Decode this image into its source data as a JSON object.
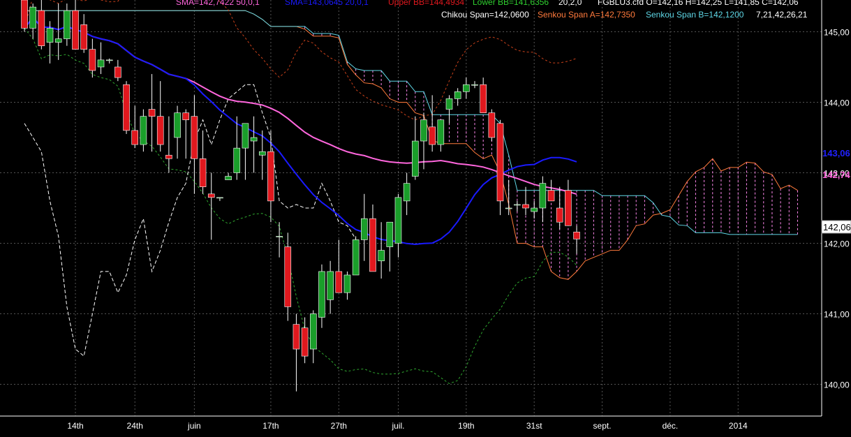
{
  "header": {
    "sma1": "SMA=142,7422  50,0,1",
    "sma2": "SMA=143,0645  20,0,1",
    "upper_bb": "Upper BB=144,4934",
    "lower_bb": "Lower BB=141,6356",
    "bb_params": "20,2,0",
    "ohlc": "FGBLU3.cfd O=142,16 H=142,25 L=141,85 C=142,06",
    "chikou": "Chikou Span=142,0600",
    "senkou_a": "Senkou Span A=142,7350",
    "senkou_b": "Senkou Span B=142,1200",
    "ichimoku_params": "7,21,42,26,21"
  },
  "price_labels": {
    "sma20": "143,06",
    "sma50": "142,74",
    "close": "142,06"
  },
  "colors": {
    "background": "#000000",
    "grid": "#555555",
    "up_candle": "#1a9e2a",
    "down_candle": "#e0181e",
    "sma20": "#1a1aff",
    "sma50": "#ff66dd",
    "chikou": "#ffffff",
    "senkou_a": "#ff7a3c",
    "senkou_b": "#5fd7e6",
    "upper_bb": "#c8401a",
    "lower_bb": "#2fa82f",
    "cloud_hatch": "#ff88ee"
  },
  "chart_data": {
    "type": "candlestick",
    "symbol": "FGBLU3.cfd",
    "ylim": [
      139.55,
      145.45
    ],
    "y_ticks": [
      140,
      141,
      142,
      143,
      144,
      145
    ],
    "y_tick_labels": [
      "140,00",
      "141,00",
      "142,00",
      "143,00",
      "144,00",
      "145,00"
    ],
    "x_tick_labels": [
      {
        "label": "14th",
        "idx": 6
      },
      {
        "label": "24th",
        "idx": 13
      },
      {
        "label": "juin",
        "idx": 20
      },
      {
        "label": "17th",
        "idx": 29
      },
      {
        "label": "27th",
        "idx": 37
      },
      {
        "label": "juil.",
        "idx": 44
      },
      {
        "label": "19th",
        "idx": 52
      },
      {
        "label": "31st",
        "idx": 60
      },
      {
        "label": "sept.",
        "idx": 68
      },
      {
        "label": "déc.",
        "idx": 76
      },
      {
        "label": "2014",
        "idx": 84
      }
    ],
    "candles": [
      {
        "o": 145.45,
        "h": 145.6,
        "l": 145.0,
        "c": 145.05
      },
      {
        "o": 145.05,
        "h": 145.4,
        "l": 144.9,
        "c": 145.35
      },
      {
        "o": 145.3,
        "h": 145.45,
        "l": 144.75,
        "c": 144.8
      },
      {
        "o": 144.85,
        "h": 145.15,
        "l": 144.55,
        "c": 145.05
      },
      {
        "o": 144.85,
        "h": 145.4,
        "l": 144.6,
        "c": 144.9
      },
      {
        "o": 144.9,
        "h": 145.4,
        "l": 144.8,
        "c": 145.3
      },
      {
        "o": 145.3,
        "h": 145.45,
        "l": 144.75,
        "c": 144.75
      },
      {
        "o": 145.1,
        "h": 145.25,
        "l": 144.7,
        "c": 144.75
      },
      {
        "o": 144.75,
        "h": 144.9,
        "l": 144.35,
        "c": 144.45
      },
      {
        "o": 144.5,
        "h": 144.85,
        "l": 144.4,
        "c": 144.6
      },
      {
        "o": 144.6,
        "h": 144.62,
        "l": 144.55,
        "c": 144.6
      },
      {
        "o": 144.5,
        "h": 144.6,
        "l": 144.3,
        "c": 144.35
      },
      {
        "o": 144.25,
        "h": 144.3,
        "l": 143.55,
        "c": 143.6
      },
      {
        "o": 143.6,
        "h": 143.95,
        "l": 143.35,
        "c": 143.4
      },
      {
        "o": 143.4,
        "h": 143.9,
        "l": 143.3,
        "c": 143.8
      },
      {
        "o": 143.9,
        "h": 144.4,
        "l": 143.3,
        "c": 143.8
      },
      {
        "o": 143.8,
        "h": 144.3,
        "l": 143.3,
        "c": 143.4
      },
      {
        "o": 143.25,
        "h": 143.8,
        "l": 143.0,
        "c": 143.2
      },
      {
        "o": 143.5,
        "h": 143.95,
        "l": 143.2,
        "c": 143.85
      },
      {
        "o": 143.85,
        "h": 143.9,
        "l": 143.2,
        "c": 143.75
      },
      {
        "o": 143.8,
        "h": 144.1,
        "l": 142.7,
        "c": 143.2
      },
      {
        "o": 143.2,
        "h": 143.6,
        "l": 142.7,
        "c": 142.8
      },
      {
        "o": 142.7,
        "h": 143.0,
        "l": 142.05,
        "c": 142.65
      },
      {
        "o": 142.65,
        "h": 142.65,
        "l": 142.6,
        "c": 142.65
      },
      {
        "o": 142.9,
        "h": 143.0,
        "l": 142.9,
        "c": 142.95
      },
      {
        "o": 143.0,
        "h": 143.8,
        "l": 142.9,
        "c": 143.35
      },
      {
        "o": 143.35,
        "h": 143.7,
        "l": 142.9,
        "c": 143.7
      },
      {
        "o": 143.45,
        "h": 143.8,
        "l": 143.0,
        "c": 143.5
      },
      {
        "o": 143.25,
        "h": 143.6,
        "l": 142.9,
        "c": 143.3
      },
      {
        "o": 143.3,
        "h": 143.6,
        "l": 142.3,
        "c": 142.6
      },
      {
        "o": 142.1,
        "h": 142.3,
        "l": 141.8,
        "c": 142.1
      },
      {
        "o": 141.95,
        "h": 142.15,
        "l": 140.9,
        "c": 141.1
      },
      {
        "o": 140.85,
        "h": 141.0,
        "l": 139.9,
        "c": 140.5
      },
      {
        "o": 140.8,
        "h": 140.95,
        "l": 140.3,
        "c": 140.4
      },
      {
        "o": 140.5,
        "h": 141.05,
        "l": 140.3,
        "c": 141.0
      },
      {
        "o": 140.95,
        "h": 141.7,
        "l": 140.8,
        "c": 141.6
      },
      {
        "o": 141.2,
        "h": 141.75,
        "l": 141.0,
        "c": 141.6
      },
      {
        "o": 141.6,
        "h": 142.05,
        "l": 141.4,
        "c": 141.3
      },
      {
        "o": 141.3,
        "h": 141.6,
        "l": 141.2,
        "c": 141.55
      },
      {
        "o": 141.55,
        "h": 142.1,
        "l": 141.55,
        "c": 142.05
      },
      {
        "o": 142.05,
        "h": 142.7,
        "l": 141.75,
        "c": 142.35
      },
      {
        "o": 142.35,
        "h": 142.55,
        "l": 141.7,
        "c": 141.6
      },
      {
        "o": 141.75,
        "h": 142.3,
        "l": 141.5,
        "c": 141.9
      },
      {
        "o": 141.95,
        "h": 142.25,
        "l": 141.6,
        "c": 142.3
      },
      {
        "o": 142.0,
        "h": 142.7,
        "l": 141.8,
        "c": 142.65
      },
      {
        "o": 142.6,
        "h": 143.0,
        "l": 142.4,
        "c": 142.85
      },
      {
        "o": 142.95,
        "h": 143.8,
        "l": 142.9,
        "c": 143.45
      },
      {
        "o": 143.45,
        "h": 143.85,
        "l": 143.05,
        "c": 143.75
      },
      {
        "o": 143.65,
        "h": 144.1,
        "l": 143.3,
        "c": 143.4
      },
      {
        "o": 143.4,
        "h": 143.75,
        "l": 143.3,
        "c": 143.75
      },
      {
        "o": 143.9,
        "h": 144.1,
        "l": 143.7,
        "c": 144.05
      },
      {
        "o": 144.05,
        "h": 144.2,
        "l": 143.95,
        "c": 144.15
      },
      {
        "o": 144.15,
        "h": 144.35,
        "l": 144.05,
        "c": 144.25
      },
      {
        "o": 144.25,
        "h": 144.3,
        "l": 144.2,
        "c": 144.25
      },
      {
        "o": 144.25,
        "h": 144.35,
        "l": 144.1,
        "c": 143.85
      },
      {
        "o": 143.85,
        "h": 143.9,
        "l": 143.45,
        "c": 143.5
      },
      {
        "o": 143.7,
        "h": 143.75,
        "l": 142.4,
        "c": 142.6
      },
      {
        "o": 142.5,
        "h": 142.9,
        "l": 142.4,
        "c": 142.5
      },
      {
        "o": 142.55,
        "h": 142.6,
        "l": 142.45,
        "c": 142.55
      },
      {
        "o": 142.55,
        "h": 142.8,
        "l": 142.4,
        "c": 142.5
      },
      {
        "o": 142.45,
        "h": 142.6,
        "l": 142.35,
        "c": 142.5
      },
      {
        "o": 142.5,
        "h": 142.95,
        "l": 142.3,
        "c": 142.85
      },
      {
        "o": 142.75,
        "h": 142.9,
        "l": 142.6,
        "c": 142.6
      },
      {
        "o": 142.5,
        "h": 142.8,
        "l": 142.2,
        "c": 142.3
      },
      {
        "o": 142.75,
        "h": 142.9,
        "l": 142.35,
        "c": 142.25
      },
      {
        "o": 142.16,
        "h": 142.25,
        "l": 141.85,
        "c": 142.06
      }
    ]
  }
}
